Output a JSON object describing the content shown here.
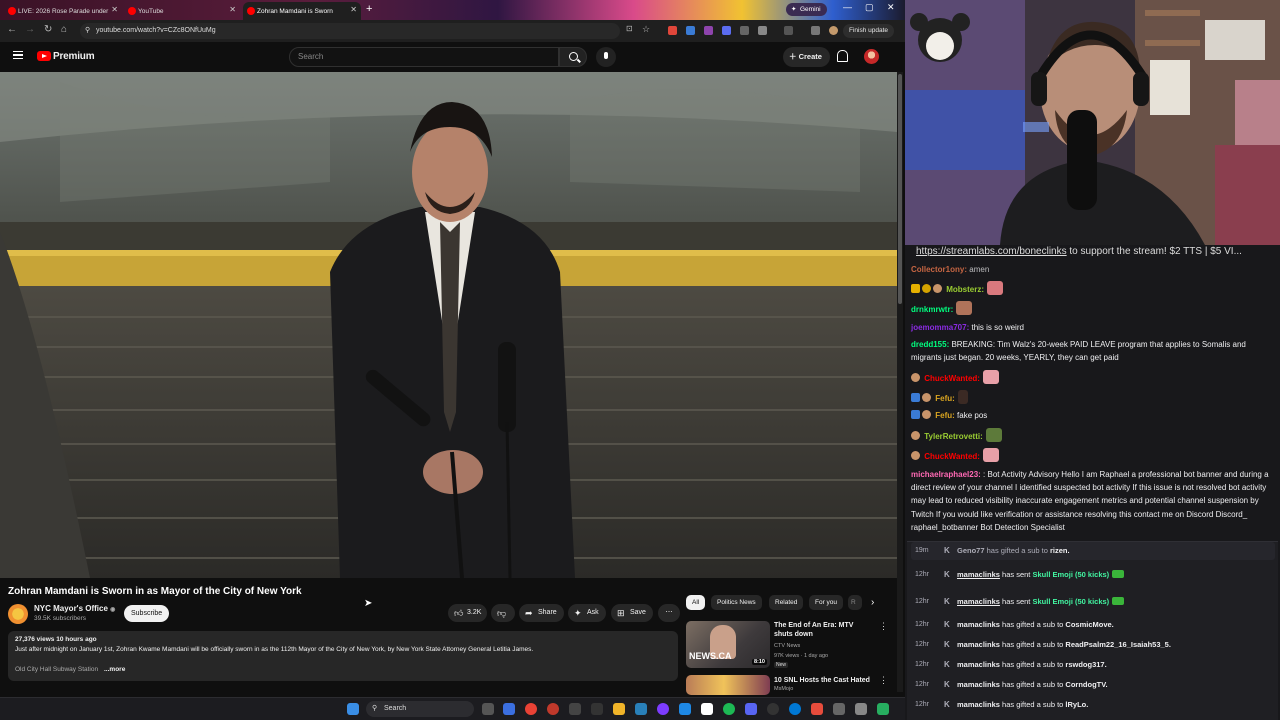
{
  "browser": {
    "tabs": [
      {
        "label": "LIVE: 2026 Rose Parade under"
      },
      {
        "label": "YouTube"
      },
      {
        "label": "Zohran Mamdani is Sworn"
      }
    ],
    "gemini_label": "Gemini",
    "url": "youtube.com/watch?v=CZc8ONfUuMg",
    "finish_update_label": "Finish update"
  },
  "youtube": {
    "brand": "Premium",
    "search_placeholder": "Search",
    "create_label": "Create",
    "video": {
      "title": "Zohran Mamdani is Sworn in as Mayor of the City of New York",
      "channel": "NYC Mayor's Office",
      "verified": "◉",
      "subscribers": "39.5K subscribers",
      "subscribe_label": "Subscribe",
      "likes": "3.2K",
      "share_label": "Share",
      "ask_label": "Ask",
      "save_label": "Save",
      "views_time": "27,376 views  10 hours ago",
      "description": "Just after midnight on January 1st, Zohran Kwame Mamdani will be officially sworn in as the 112th Mayor of the City of New York, by New York State Attorney General Letitia James.",
      "location": "Old City Hall Subway Station",
      "more_label": "...more"
    },
    "chips": [
      "All",
      "Politics News",
      "Related",
      "For you",
      "R"
    ],
    "recommendations": [
      {
        "title": "The End of An Era: MTV shuts down",
        "channel": "CTV News",
        "meta": "97K views · 1 day ago",
        "badge": "New",
        "duration": "8:10",
        "thumb_text": "NEWS.CA"
      },
      {
        "title": "10 SNL Hosts the Cast Hated",
        "channel": "MsMojo",
        "meta": "",
        "badge": "",
        "duration": "",
        "thumb_text": ""
      }
    ]
  },
  "stream": {
    "link_text": "https://streamlabs.com/boneclinks",
    "link_suffix": " to support the stream! $2 TTS | $5 VI...",
    "chat": [
      {
        "user": "Collector1ony:",
        "text": "amen",
        "color": "#ff7f50"
      },
      {
        "user": "Mobsterz:",
        "text": "",
        "color": "#9acd32"
      },
      {
        "user": "drnkmrwtr:",
        "text": "",
        "color": "#00ff7f"
      },
      {
        "user": "joemomma707:",
        "text": "this is so weird",
        "color": "#8a2be2"
      },
      {
        "user": "dredd155:",
        "text": "BREAKING: Tim Walz's 20-week PAID LEAVE program that applies to Somalis and migrants just began. 20 weeks, YEARLY, they can get paid",
        "color": "#00ff7f"
      },
      {
        "user": "ChuckWanted:",
        "text": "",
        "color": "#ff0000"
      },
      {
        "user": "Fefu:",
        "text": "",
        "color": "#daa520"
      },
      {
        "user": "Fefu:",
        "text": "fake pos",
        "color": "#daa520"
      },
      {
        "user": "TylerRetrovetti:",
        "text": "",
        "color": "#9acd32"
      },
      {
        "user": "ChuckWanted:",
        "text": "",
        "color": "#ff0000"
      },
      {
        "user": "michaelraphael23:",
        "text": ": Bot Activity Advisory Hello I am Raphael a professional bot banner and during a direct review of your channel I identified suspected bot activity If this issue is not resolved bot activity may lead to reduced visibility inaccurate engagement metrics and potential channel suspension by Twitch If you would like verification or assistance resolving this contact me on Discord Discord_ raphael_botbanner Bot Detection Specialist",
        "color": "#ff69b4"
      }
    ],
    "events": [
      {
        "time": "19m",
        "user": "Geno77",
        "pre": " has gifted a sub to ",
        "target": "rizen.",
        "item": ""
      },
      {
        "time": "12hr",
        "user": "mamaclinks",
        "pre": " has sent ",
        "target": "",
        "item": "Skull Emoji (50 kicks)"
      },
      {
        "time": "12hr",
        "user": "mamaclinks",
        "pre": " has sent ",
        "target": "",
        "item": "Skull Emoji (50 kicks)"
      },
      {
        "time": "12hr",
        "user": "mamaclinks",
        "pre": " has gifted a sub to ",
        "target": "CosmicMove.",
        "item": ""
      },
      {
        "time": "12hr",
        "user": "mamaclinks",
        "pre": " has gifted a sub to ",
        "target": "ReadPsalm22_16_Isaiah53_5.",
        "item": ""
      },
      {
        "time": "12hr",
        "user": "mamaclinks",
        "pre": " has gifted a sub to ",
        "target": "rswdog317.",
        "item": ""
      },
      {
        "time": "12hr",
        "user": "mamaclinks",
        "pre": " has gifted a sub to ",
        "target": "CorndogTV.",
        "item": ""
      },
      {
        "time": "12hr",
        "user": "mamaclinks",
        "pre": " has gifted a sub to ",
        "target": "lRyLo.",
        "item": ""
      }
    ]
  },
  "taskbar": {
    "search_label": "Search"
  }
}
